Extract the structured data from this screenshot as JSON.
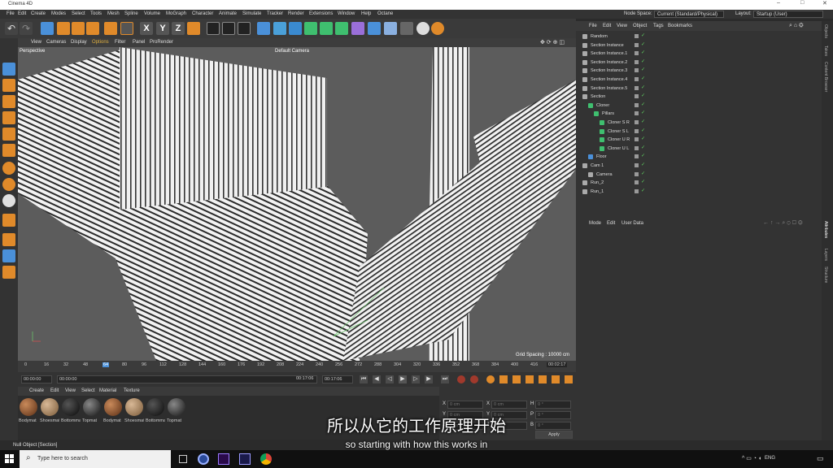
{
  "app": {
    "title": "Cinema 4D",
    "window_controls": [
      "–",
      "□",
      "✕"
    ]
  },
  "menubar": {
    "items": [
      "File",
      "Edit",
      "Create",
      "Modes",
      "Select",
      "Tools",
      "Mesh",
      "Spline",
      "Volume",
      "MoGraph",
      "Character",
      "Animate",
      "Simulate",
      "Tracker",
      "Render",
      "Extensions",
      "Window",
      "Help",
      "Octane"
    ],
    "node_space_label": "Node Space:",
    "node_space_value": "Current (Standard/Physical)",
    "layout_label": "Layout:",
    "layout_value": "Startup (User)"
  },
  "toolbar": {
    "xyz": [
      "X",
      "Y",
      "Z"
    ]
  },
  "viewport": {
    "menu": [
      "View",
      "Cameras",
      "Display",
      "Options",
      "Filter",
      "Panel",
      "ProRender"
    ],
    "projection": "Perspective",
    "camera": "Default Camera",
    "grid_spacing": "Grid Spacing : 10000 cm"
  },
  "timeline": {
    "ticks": [
      "0",
      "16",
      "32",
      "48",
      "64",
      "80",
      "96",
      "112",
      "128",
      "144",
      "160",
      "176",
      "192",
      "208",
      "224",
      "240",
      "256",
      "272",
      "288",
      "304",
      "320",
      "336",
      "352",
      "368",
      "384",
      "400",
      "416"
    ],
    "current_frame": "00:02:17"
  },
  "transport": {
    "start": "00:00:00",
    "current": "00:00:00",
    "end": "00:17:06",
    "end2": "00:17:06"
  },
  "materials": {
    "menu": [
      "Create",
      "Edit",
      "View",
      "Select",
      "Material",
      "Texture"
    ],
    "items": [
      "Bodymat",
      "Shoesmat",
      "Bottommat",
      "Topmat",
      "Bodymat",
      "Shoesmat",
      "Bottommat",
      "Topmat"
    ]
  },
  "coords": {
    "labels": [
      "X",
      "Y",
      "Z"
    ],
    "values": [
      "0 cm",
      "0 cm",
      "0 cm"
    ],
    "size_labels": [
      "X",
      "Y",
      "Z"
    ],
    "size_values": [
      "0 cm",
      "0 cm",
      "0 cm"
    ],
    "rot_labels": [
      "H",
      "P",
      "B"
    ],
    "rot_values": [
      "0 °",
      "0 °",
      "0 °"
    ],
    "apply": "Apply"
  },
  "objects": {
    "menu": [
      "File",
      "Edit",
      "View",
      "Object",
      "Tags",
      "Bookmarks"
    ],
    "rows": [
      "Random",
      "Section Instance",
      "Section Instance.1",
      "Section Instance.2",
      "Section Instance.3",
      "Section Instance.4",
      "Section Instance.5",
      "Section",
      "Cloner",
      "Pillars",
      "Cloner S R",
      "Cloner S L",
      "Cloner U R",
      "Cloner U L",
      "Floor",
      "Cam 1",
      "Camera",
      "Run_2",
      "Run_1"
    ]
  },
  "attributes": {
    "menu": [
      "Mode",
      "Edit",
      "User Data"
    ]
  },
  "sidetabs": [
    "Objects",
    "Takes",
    "Content Browser",
    "Attributes",
    "Layers",
    "Structure"
  ],
  "status": {
    "text": "Null Object [Section]"
  },
  "taskbar": {
    "search_placeholder": "Type here to search",
    "lang": "ENG"
  },
  "subtitles": {
    "cn": "所以从它的工作原理开始",
    "en": "so starting with how this works in"
  },
  "colors": {
    "accent": "#4a90d9",
    "check_green": "#5fcf5f",
    "bg": "#333333"
  }
}
